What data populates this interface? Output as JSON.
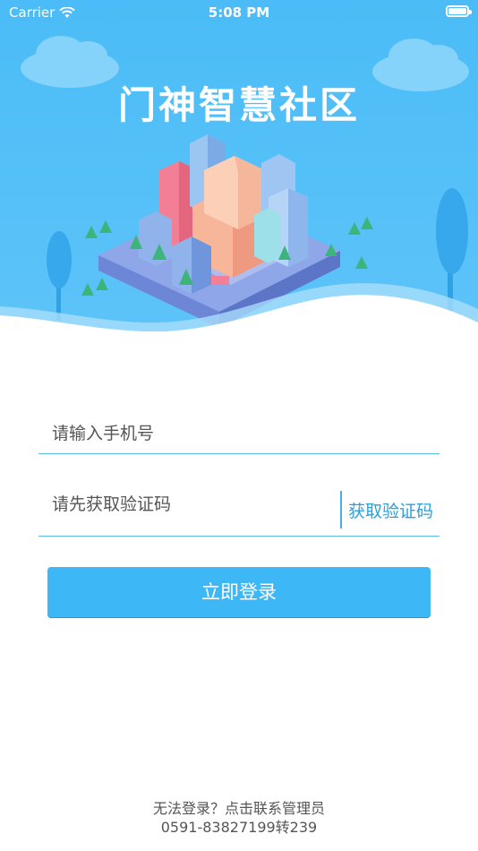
{
  "status_bar": {
    "carrier": "Carrier",
    "time": "5:08 PM",
    "battery_level": 1.0
  },
  "header": {
    "title": "门神智慧社区"
  },
  "form": {
    "phone_placeholder": "请输入手机号",
    "code_placeholder": "请先获取验证码",
    "get_code_label": "获取验证码",
    "login_label": "立即登录"
  },
  "footer": {
    "help_text": "无法登录？点击联系管理员",
    "phone": "0591-83827199转239"
  },
  "colors": {
    "primary": "#3db7f6",
    "hero_bg": "#4bbcf7",
    "link": "#2a9fdc",
    "line": "#5bbbe9"
  }
}
